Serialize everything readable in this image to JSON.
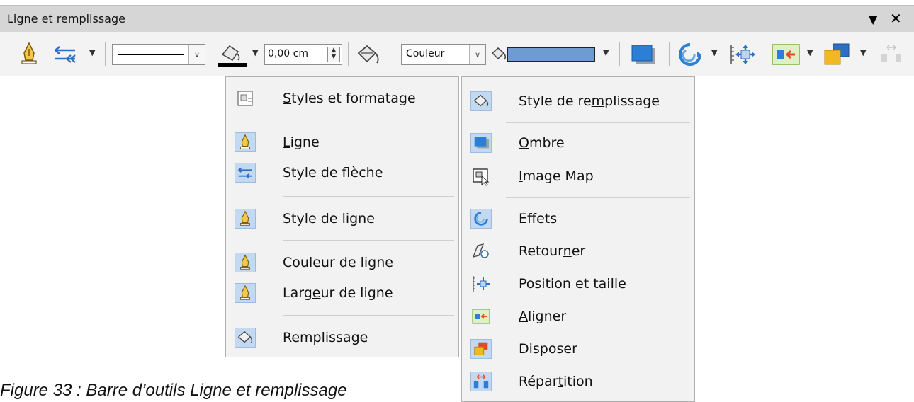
{
  "panel": {
    "title": "Ligne et remplissage",
    "menu_arrow": "▼",
    "close": "✕"
  },
  "toolbar": {
    "line_width_value": "0,00 cm",
    "fill_type_value": "Couleur",
    "fill_color": "#6e9bd0",
    "icons": [
      "line-icon",
      "arrow-style-icon",
      "line-style-combo",
      "line-color-icon",
      "line-width-spin",
      "fill-icon",
      "fill-type-combo",
      "fill-color-swatch",
      "shadow-icon",
      "effects-icon",
      "position-size-icon",
      "align-icon",
      "arrange-icon",
      "distribution-icon"
    ]
  },
  "menu_left": {
    "items": [
      {
        "pre": "",
        "key": "S",
        "post": "tyles et formatage",
        "icon": "styles-icon"
      },
      {
        "pre": "",
        "key": "L",
        "post": "igne",
        "icon": "line-icon"
      },
      {
        "pre": "Style ",
        "key": "d",
        "post": "e flèche",
        "icon": "arrow-style-icon"
      },
      {
        "pre": "St",
        "key": "y",
        "post": "le de ligne",
        "icon": "line-style-icon"
      },
      {
        "pre": "",
        "key": "C",
        "post": "ouleur de ligne",
        "icon": "line-color-icon"
      },
      {
        "pre": "Larg",
        "key": "e",
        "post": "ur de ligne",
        "icon": "line-width-icon"
      },
      {
        "pre": "",
        "key": "R",
        "post": "emplissage",
        "icon": "fill-icon"
      }
    ]
  },
  "menu_right": {
    "items": [
      {
        "pre": "Style de re",
        "key": "m",
        "post": "plissage",
        "icon": "fill-style-icon"
      },
      {
        "pre": "",
        "key": "O",
        "post": "mbre",
        "icon": "shadow-icon"
      },
      {
        "pre": "",
        "key": "I",
        "post": "mage Map",
        "icon": "image-map-icon"
      },
      {
        "pre": "",
        "key": "E",
        "post": "ffets",
        "icon": "effects-icon"
      },
      {
        "pre": "Retour",
        "key": "n",
        "post": "er",
        "icon": "flip-icon"
      },
      {
        "pre": "",
        "key": "P",
        "post": "osition et taille",
        "icon": "position-size-icon"
      },
      {
        "pre": "",
        "key": "A",
        "post": "ligner",
        "icon": "align-icon"
      },
      {
        "pre": "Disposer",
        "key": "",
        "post": "",
        "icon": "arrange-icon"
      },
      {
        "pre": "Répar",
        "key": "t",
        "post": "ition",
        "icon": "distribution-icon"
      }
    ]
  },
  "caption": "Figure 33 : Barre d’outils Ligne et remplissage"
}
